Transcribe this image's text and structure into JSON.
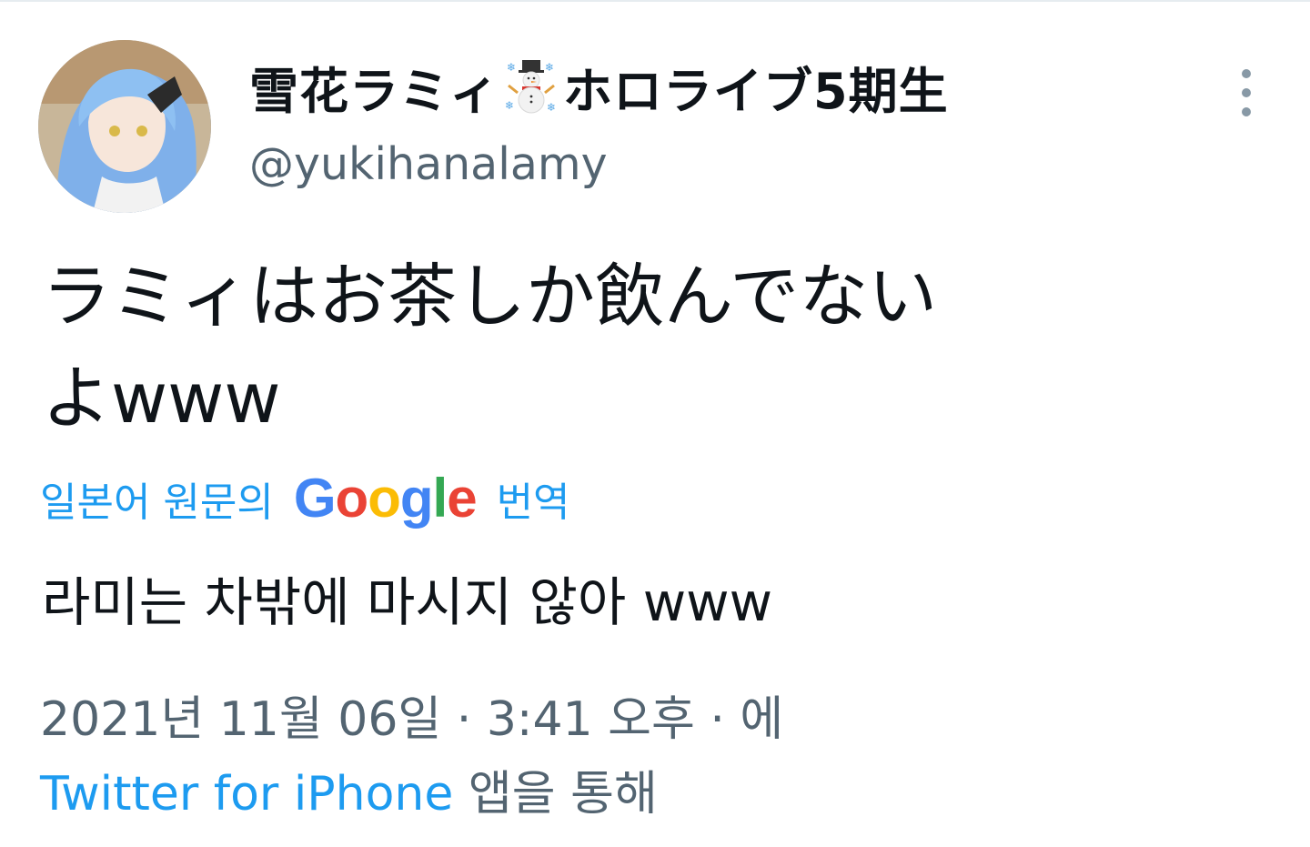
{
  "tweet": {
    "display_name": "雪花ラミィ",
    "display_name_suffix": "ホロライブ5期生",
    "name_emoji": "snowman-icon",
    "username": "@yukihanalamy",
    "text_line1": "ラミィはお茶しか飲んでない",
    "text_line2": "よwww",
    "translation_label_prefix": "일본어 원문의",
    "translation_brand": "Google",
    "translation_label_suffix": "번역",
    "translated_text": "라미는 차밖에 마시지 않아 www",
    "timestamp": "2021년 11월 06일 · 3:41 오후 · 에",
    "source_app": "Twitter for iPhone",
    "source_suffix": "앱을 통해"
  },
  "icons": {
    "more": "more-vertical-icon",
    "snowman": "snowman-icon"
  },
  "colors": {
    "link_blue": "#1d9bf0",
    "secondary_text": "#536471",
    "primary_text": "#0f1419"
  }
}
